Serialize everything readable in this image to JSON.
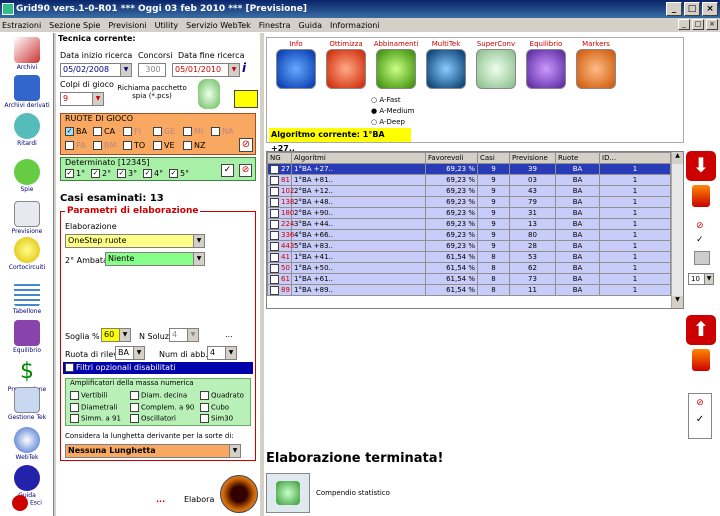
{
  "window": {
    "title": "Grid90 vers.1-0-R01  ***  Oggi 03 feb 2010  ***  [Previsione]"
  },
  "menu": [
    "Estrazioni",
    "Sezione Spie",
    "Previsioni",
    "Utility",
    "Servizio WebTek",
    "Finestra",
    "Guida",
    "Informazioni"
  ],
  "sidebar": [
    "Archivi",
    "Archivi derivati",
    "Ritardi",
    "Spie",
    "Previsione",
    "Cortocircuiti",
    "Tabellone",
    "Equilibrio",
    "Progressione",
    "Gestione Tek",
    "WebTek",
    "Guida",
    "Esci"
  ],
  "form": {
    "section": "Tecnica corrente:",
    "date_start_label": "Data inizio ricerca",
    "date_start": "05/02/2008",
    "concorsi_label": "Concorsi",
    "concorsi": "300",
    "date_end_label": "Data fine ricerca",
    "date_end": "05/01/2010",
    "colpi_label": "Colpi di gioco",
    "colpi": "9",
    "richiama_label": "Richiama pacchetto spia (*.pcs)",
    "ruote_label": "RUOTE DI GIOCO",
    "ruote_row1": [
      "BA",
      "CA",
      "FI",
      "GE",
      "MI",
      "NA"
    ],
    "ruote_row2": [
      "PA",
      "RM",
      "TO",
      "VE",
      "NZ"
    ],
    "determinato_label": "Determinato [12345]",
    "determinato": [
      "1°",
      "2°",
      "3°",
      "4°",
      "5°"
    ],
    "casi": "Casi esaminati: 13",
    "params_title": "Parametri di elaborazione",
    "elab_label": "Elaborazione",
    "elab": "OneStep ruote",
    "ambata_label": "2° Ambata",
    "ambata": "Niente",
    "soglia_label": "Soglia %",
    "soglia": "60",
    "nsoluz_label": "N Soluz.",
    "nsoluz": "4",
    "ruota_label": "Ruota di rilev.",
    "ruota": "BA",
    "abb_label": "Num di abb.",
    "abb": "4",
    "filtri": "Filtri opzionali disabilitati",
    "ampl_title": "Amplificatori della massa numerica",
    "ampl": [
      "Vertibili",
      "Diam. decina",
      "Quadrato",
      "Diametrali",
      "Complem. a 90",
      "Cubo",
      "Simm. a 91",
      "Oscillatori",
      "Sim30"
    ],
    "lunghezza_label": "Considera la lunghetta derivante per la sorte di:",
    "lunghezza": "Nessuna Lunghetta",
    "elabora": "Elabora"
  },
  "toolbar": [
    "Info",
    "Ottimizza",
    "Abbinamenti",
    "MultiTek",
    "SuperConv",
    "Equilibrio",
    "Markers"
  ],
  "algos": [
    "A-Fast",
    "A-Medium",
    "A-Deep"
  ],
  "algo_current": "Algoritmo corrente: 1°BA +27..",
  "grid": {
    "headers": [
      "NG",
      "Algoritmi",
      "Favorevoli",
      "Casi",
      "Previsione",
      "Ruote",
      "ID..."
    ],
    "rows": [
      [
        "27",
        "1°BA +27..",
        "69,23 %",
        "9",
        "39",
        "BA",
        "1"
      ],
      [
        "81",
        "1°BA +81..",
        "69,23 %",
        "9",
        "03",
        "BA",
        "1"
      ],
      [
        "102",
        "2°BA +12..",
        "69,23 %",
        "9",
        "43",
        "BA",
        "1"
      ],
      [
        "138",
        "2°BA +48..",
        "69,23 %",
        "9",
        "79",
        "BA",
        "1"
      ],
      [
        "180",
        "2°BA +90..",
        "69,23 %",
        "9",
        "31",
        "BA",
        "1"
      ],
      [
        "224",
        "3°BA +44..",
        "69,23 %",
        "9",
        "13",
        "BA",
        "1"
      ],
      [
        "336",
        "4°BA +66..",
        "69,23 %",
        "9",
        "80",
        "BA",
        "1"
      ],
      [
        "443",
        "5°BA +83..",
        "69,23 %",
        "9",
        "28",
        "BA",
        "1"
      ],
      [
        "41",
        "1°BA +41..",
        "61,54 %",
        "8",
        "53",
        "BA",
        "1"
      ],
      [
        "50",
        "1°BA +50..",
        "61,54 %",
        "8",
        "62",
        "BA",
        "1"
      ],
      [
        "61",
        "1°BA +61..",
        "61,54 %",
        "8",
        "73",
        "BA",
        "1"
      ],
      [
        "89",
        "1°BA +89..",
        "61,54 %",
        "8",
        "11",
        "BA",
        "1"
      ]
    ]
  },
  "status": "Elaborazione terminata!",
  "compendio": "Compendio statistico",
  "spin": "10"
}
